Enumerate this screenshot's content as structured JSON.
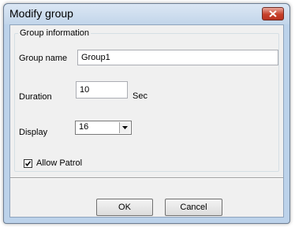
{
  "window": {
    "title": "Modify group"
  },
  "group": {
    "legend": "Group information",
    "name_label": "Group name",
    "name_value": "Group1",
    "duration_label": "Duration",
    "duration_value": "10",
    "duration_unit": "Sec",
    "display_label": "Display",
    "display_value": "16",
    "allow_patrol_label": "Allow Patrol",
    "allow_patrol_checked": true
  },
  "buttons": {
    "ok_label": "OK",
    "cancel_label": "Cancel"
  },
  "icons": {
    "close": "close-icon",
    "dropdown": "chevron-down-icon",
    "check": "checkmark-icon"
  }
}
